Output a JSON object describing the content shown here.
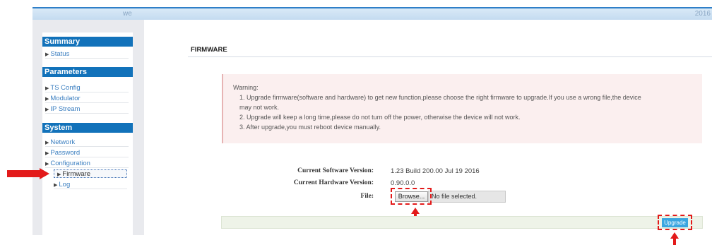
{
  "header": {
    "brand": "we",
    "year": "2016"
  },
  "sidebar": {
    "sections": [
      {
        "title": "Summary",
        "items": [
          {
            "label": "Status"
          }
        ]
      },
      {
        "title": "Parameters",
        "items": [
          {
            "label": "TS Config"
          },
          {
            "label": "Modulator"
          },
          {
            "label": "IP Stream"
          }
        ]
      },
      {
        "title": "System",
        "items": [
          {
            "label": "Network"
          },
          {
            "label": "Password"
          },
          {
            "label": "Configuration"
          },
          {
            "label": "Firmware"
          },
          {
            "label": "Log"
          }
        ]
      }
    ],
    "active_item": "Firmware"
  },
  "page": {
    "title": "FIRMWARE"
  },
  "warning": {
    "title": "Warning:",
    "lines": [
      "1. Upgrade firmware(software and hardware) to get new function,please choose the right firmware to upgrade.If you use a wrong file,the device",
      "may not work.",
      "2. Upgrade will keep a long time,please do not turn off the power, otherwise the device will not work.",
      "3. After upgrade,you must reboot device manually."
    ]
  },
  "form": {
    "software_label": "Current Software Version:",
    "software_value": "1.23 Build 200.00 Jul 19 2016",
    "hardware_label": "Current Hardware Version:",
    "hardware_value": "0.90.0.0",
    "file_label": "File:",
    "browse_label": "Browse...",
    "file_status": "No file selected.",
    "upgrade_label": "Upgrade"
  },
  "colors": {
    "accent": "#1272ba",
    "annotation": "#e31a1a",
    "upgrade_button": "#3aa6e0"
  }
}
